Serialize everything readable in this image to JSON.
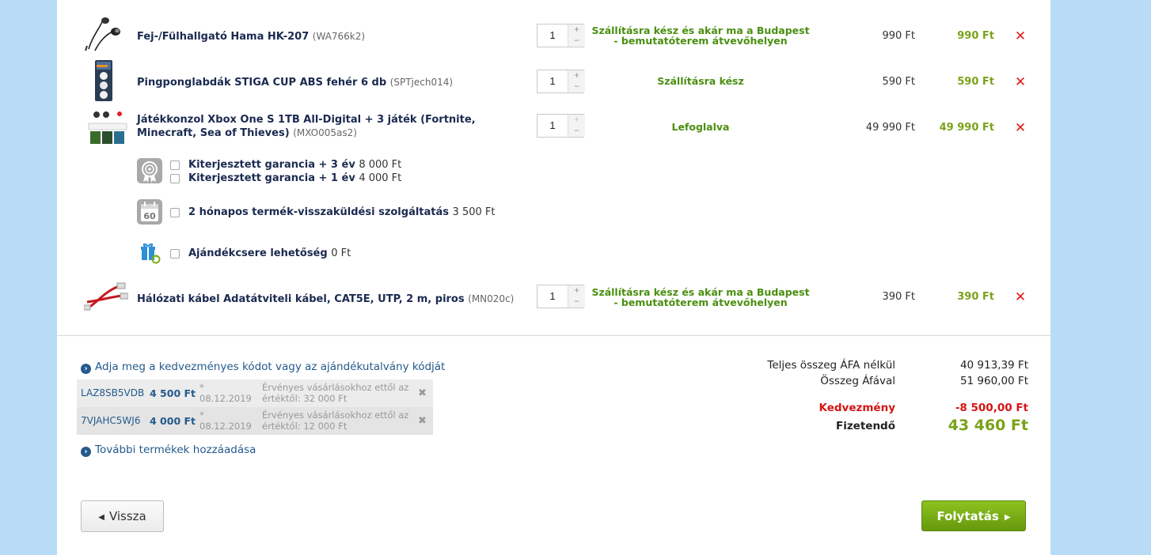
{
  "products": [
    {
      "name": "Fej-/Fülhallgató Hama HK-207",
      "code": "(WA766k2)",
      "qty": "1",
      "availability": "Szállításra kész és akár ma a Budapest - bemutatóterem átvevőhelyen",
      "unit_price": "990 Ft",
      "total_price": "990 Ft",
      "image_icon": "earphones-image"
    },
    {
      "name": "Pingponglabdák STIGA CUP ABS fehér 6 db",
      "code": "(SPTjech014)",
      "qty": "1",
      "availability": "Szállításra kész",
      "unit_price": "590 Ft",
      "total_price": "590 Ft",
      "image_icon": "pingpong-balls-image"
    },
    {
      "name": "Játékkonzol Xbox One S 1TB All-Digital + 3 játék (Fortnite, Minecraft, Sea of Thieves)",
      "code": "(MXO005as2)",
      "qty": "1",
      "availability": "Lefoglalva",
      "unit_price": "49 990 Ft",
      "total_price": "49 990 Ft",
      "image_icon": "xbox-console-image"
    },
    {
      "name": "Hálózati kábel Adatátviteli kábel, CAT5E, UTP, 2 m, piros",
      "code": "(MN020c)",
      "qty": "1",
      "availability": "Szállításra kész és akár ma a Budapest - bemutatóterem átvevőhelyen",
      "unit_price": "390 Ft",
      "total_price": "390 Ft",
      "image_icon": "network-cable-image"
    }
  ],
  "services": {
    "warranty_3": {
      "label": "Kiterjesztett garancia + 3 év",
      "price": "8 000 Ft"
    },
    "warranty_1": {
      "label": "Kiterjesztett garancia + 1 év",
      "price": "4 000 Ft"
    },
    "return": {
      "label": "2 hónapos termék-visszaküldési szolgáltatás",
      "price": "3 500 Ft",
      "icon_text": "60"
    },
    "gift": {
      "label": "Ajándékcsere lehetőség",
      "price": "0 Ft"
    }
  },
  "discount_link": "Adja meg a kedvezményes kódot vagy az ajándékutalvány kódját",
  "coupons": [
    {
      "code": "LAZ8SB5VDB",
      "amount": "4 500 Ft",
      "date": "* 08.12.2019",
      "desc": "Érvényes vásárlásokhoz ettől az értéktől: 32 000 Ft"
    },
    {
      "code": "7VJAHC5WJ6",
      "amount": "4 000 Ft",
      "date": "* 08.12.2019",
      "desc": "Érvényes vásárlásokhoz ettől az értéktől: 12 000 Ft"
    }
  ],
  "more_products_link": "További termékek hozzáadása",
  "summary": {
    "net_label": "Teljes összeg ÁFA nélkül",
    "net_value": "40 913,39 Ft",
    "gross_label": "Összeg Áfával",
    "gross_value": "51 960,00 Ft",
    "discount_label": "Kedvezmény",
    "discount_value": "-8 500,00 Ft",
    "pay_label": "Fizetendő",
    "pay_value": "43 460 Ft"
  },
  "buttons": {
    "back": "Vissza",
    "next": "Folytatás"
  },
  "colors": {
    "background": "#b9dcf6",
    "price_green": "#7aa21a",
    "availability_green": "#4a8f0f",
    "remove_red": "#e01a1a",
    "link_blue": "#245a8c",
    "discount_red": "#d41515",
    "button_green": "#7cb016"
  }
}
